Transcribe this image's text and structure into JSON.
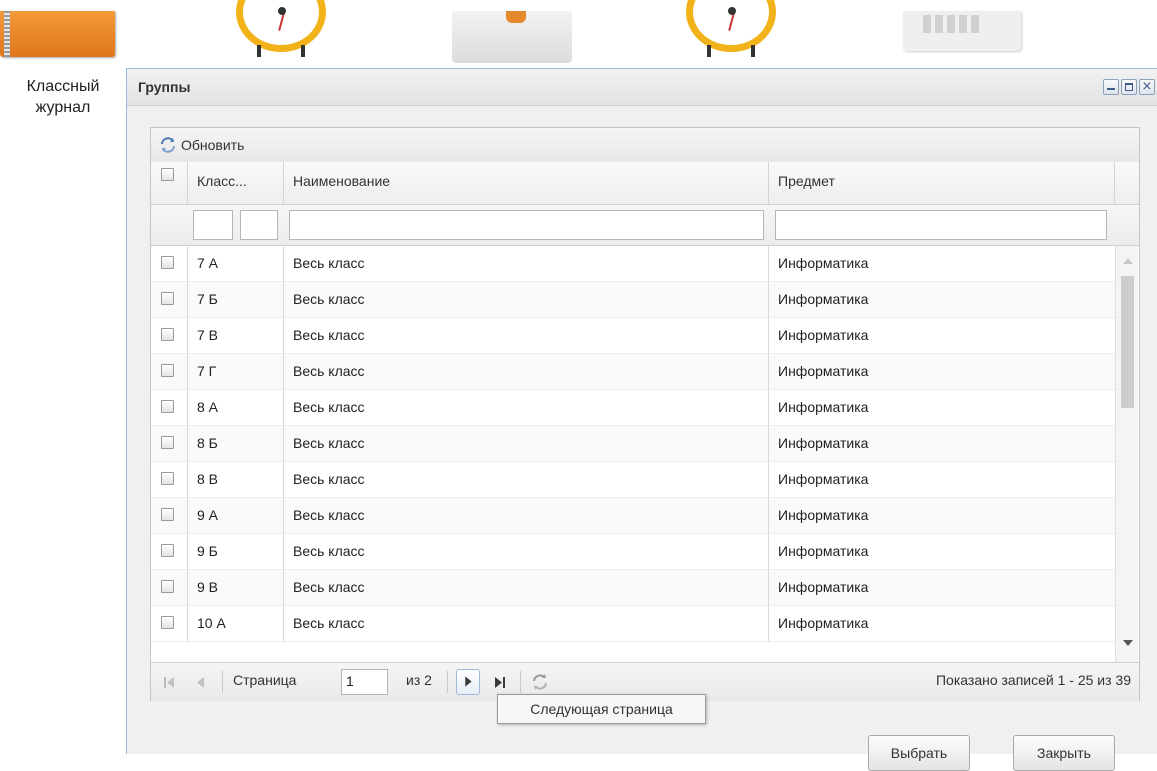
{
  "desktop": {
    "journal_label": "Классный журнал",
    "icons": [
      "book-icon",
      "alarm-clock-icon",
      "envelope-icon",
      "alarm-clock-icon",
      "calendar-icon"
    ]
  },
  "window": {
    "title": "Группы",
    "toolbar": {
      "refresh_label": "Обновить"
    },
    "columns": {
      "class": "Класс...",
      "name": "Наименование",
      "subject": "Предмет"
    },
    "rows": [
      {
        "class": "7 А",
        "name": "Весь класс",
        "subject": "Информатика"
      },
      {
        "class": "7 Б",
        "name": "Весь класс",
        "subject": "Информатика"
      },
      {
        "class": "7 В",
        "name": "Весь класс",
        "subject": "Информатика"
      },
      {
        "class": "7 Г",
        "name": "Весь класс",
        "subject": "Информатика"
      },
      {
        "class": "8 А",
        "name": "Весь класс",
        "subject": "Информатика"
      },
      {
        "class": "8 Б",
        "name": "Весь класс",
        "subject": "Информатика"
      },
      {
        "class": "8 В",
        "name": "Весь класс",
        "subject": "Информатика"
      },
      {
        "class": "9 А",
        "name": "Весь класс",
        "subject": "Информатика"
      },
      {
        "class": "9 Б",
        "name": "Весь класс",
        "subject": "Информатика"
      },
      {
        "class": "9 В",
        "name": "Весь класс",
        "subject": "Информатика"
      },
      {
        "class": "10 А",
        "name": "Весь класс",
        "subject": "Информатика"
      }
    ],
    "paging": {
      "page_label": "Страница",
      "page_value": "1",
      "of_label": "из 2",
      "summary": "Показано записей 1 - 25 из 39"
    },
    "tooltip": "Следующая страница",
    "buttons": {
      "select": "Выбрать",
      "close": "Закрыть"
    }
  }
}
